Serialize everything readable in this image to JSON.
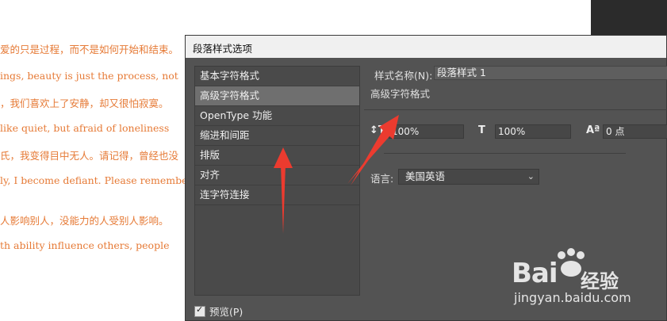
{
  "background_document": {
    "lines": [
      "爱的只是过程，而不是如何开始和结束。",
      "ings, beauty is just the process, not",
      "，我们喜欢上了安静，却又很怕寂寞。",
      " like quiet, but afraid of loneliness",
      "氏，我变得目中无人。请记得，曾经也没",
      "ly, I become defiant. Please remember",
      "人影响别人，没能力的人受别人影响。",
      "th ability influence others, people"
    ],
    "text_color": "#e67a36"
  },
  "dialog": {
    "title": "段落样式选项",
    "categories": [
      {
        "label": "基本字符格式",
        "selected": false
      },
      {
        "label": "高级字符格式",
        "selected": true
      },
      {
        "label": "OpenType 功能",
        "selected": false
      },
      {
        "label": "缩进和间距",
        "selected": false
      },
      {
        "label": "排版",
        "selected": false
      },
      {
        "label": "对齐",
        "selected": false
      },
      {
        "label": "连字符连接",
        "selected": false
      }
    ],
    "preview_label": "预览(P)",
    "preview_checked": true,
    "style_name_label": "样式名称(N):",
    "style_name_value": "段落样式 1",
    "section_title": "高级字符格式",
    "vertical_scale": "100%",
    "horizontal_scale": "100%",
    "baseline_shift": "0 点",
    "language_label": "语言:",
    "language_value": "美国英语",
    "icons": {
      "vertical_scale": "vertical-scale-icon",
      "horizontal_scale": "horizontal-scale-icon",
      "baseline_shift": "baseline-shift-icon"
    }
  },
  "annotations": {
    "arrow_color": "#f0392b"
  },
  "watermark": {
    "logo_left": "Bai",
    "logo_right": "经验",
    "url": "jingyan.baidu.com"
  }
}
